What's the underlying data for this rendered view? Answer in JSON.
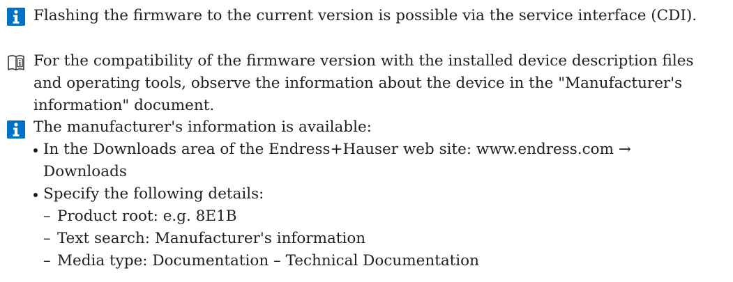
{
  "note_1": {
    "icon": "info-icon",
    "text": "Flashing the firmware to the current version is possible via the service interface (CDI)."
  },
  "note_2": {
    "icon": "book-reference-icon",
    "lines": [
      "For the compatibility of the firmware version with the installed device description files",
      "and operating tools, observe the information about the device in the \"Manufacturer's",
      "information\" document."
    ]
  },
  "note_3": {
    "icon": "info-icon",
    "intro": "The manufacturer's information is available:",
    "bullets": [
      {
        "lines": [
          "In the Downloads area of the Endress+Hauser web site: www.endress.com →",
          "Downloads"
        ]
      },
      {
        "lines": [
          "Specify the following details:"
        ],
        "subitems": [
          "Product root: e.g. 8E1B",
          "Text search: Manufacturer's information",
          "Media type: Documentation – Technical Documentation"
        ]
      }
    ],
    "subitem_marker": "–"
  },
  "colors": {
    "info_icon_blue": "#0072c6",
    "text": "#1f1f1f",
    "book_icon_stroke": "#333333"
  }
}
